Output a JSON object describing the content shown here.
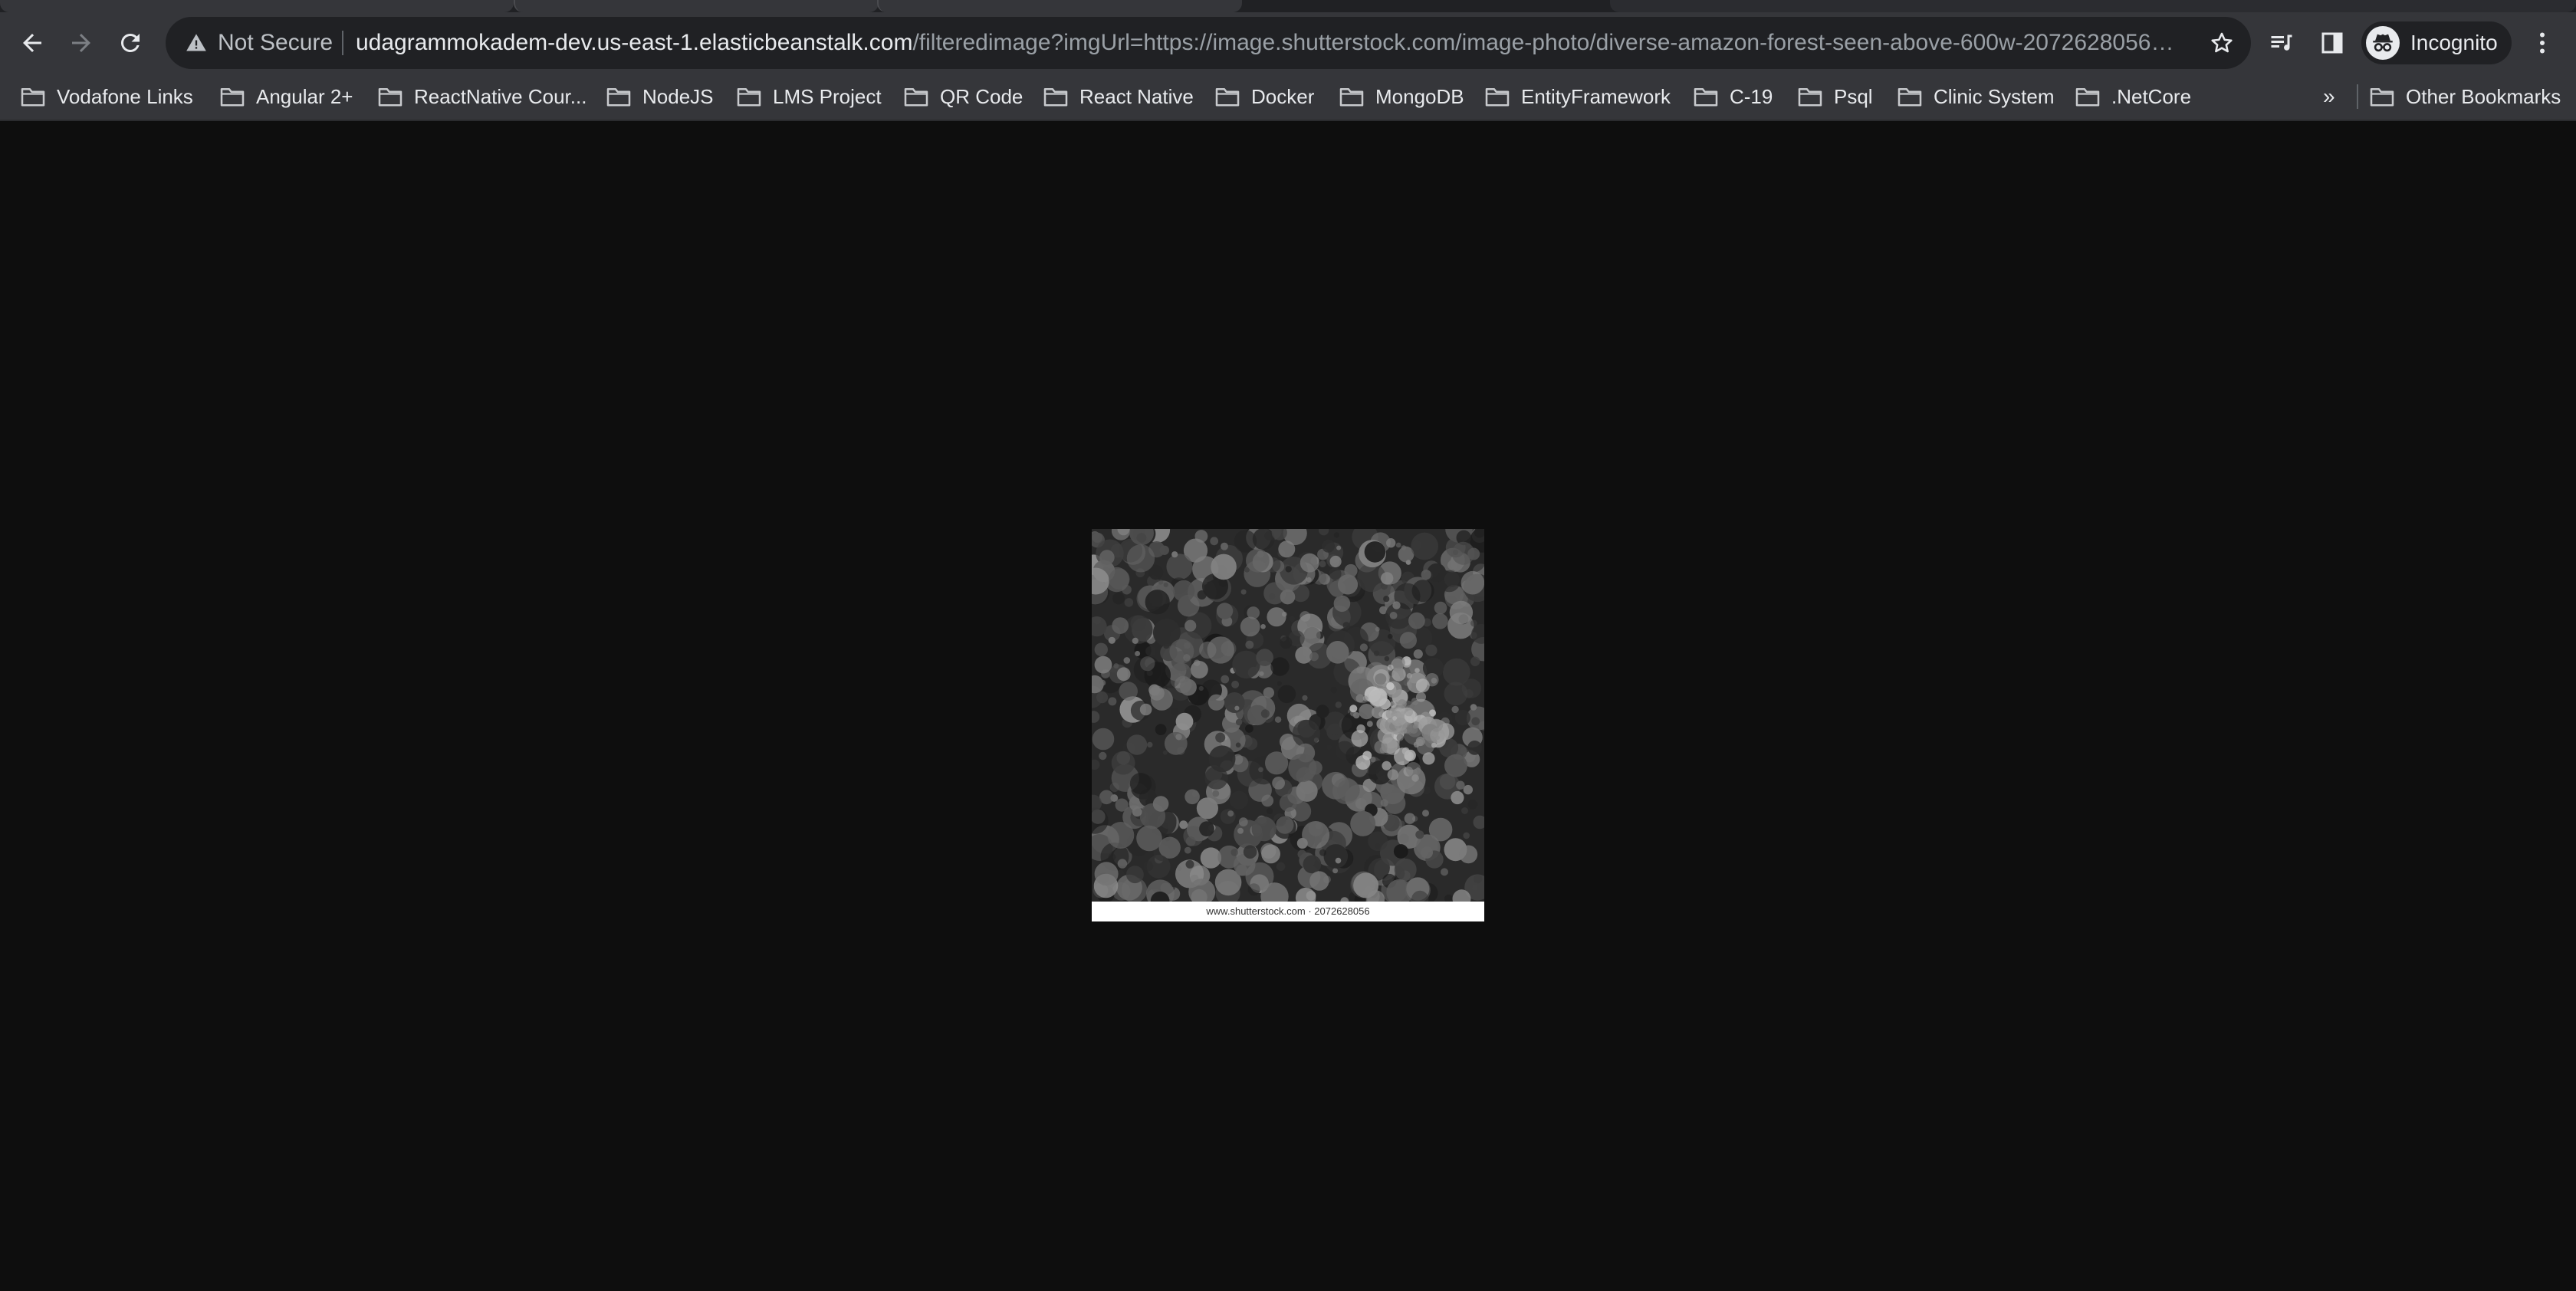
{
  "toolbar": {
    "security_text": "Not Secure",
    "url_host": "udagrammokadem-dev.us-east-1.elasticbeanstalk.com",
    "url_path": "/filteredimage?imgUrl=https://image.shutterstock.com/image-photo/diverse-amazon-forest-seen-above-600w-2072628056…",
    "profile_label": "Incognito"
  },
  "bookmarks": {
    "items": [
      {
        "label": "Vodafone Links"
      },
      {
        "label": "Angular 2+"
      },
      {
        "label": "ReactNative Cour..."
      },
      {
        "label": "NodeJS"
      },
      {
        "label": "LMS Project"
      },
      {
        "label": "QR Code"
      },
      {
        "label": "React Native"
      },
      {
        "label": "Docker"
      },
      {
        "label": "MongoDB"
      },
      {
        "label": "EntityFramework"
      },
      {
        "label": "C-19"
      },
      {
        "label": "Psql"
      },
      {
        "label": "Clinic System"
      },
      {
        "label": ".NetCore"
      }
    ],
    "overflow_label": "»",
    "other_label": "Other Bookmarks"
  },
  "content": {
    "image_caption": "www.shutterstock.com · 2072628056"
  },
  "colors": {
    "page_background": "#0e0e0e",
    "toolbar_background": "#35363a",
    "omnibox_background": "#202124"
  },
  "icons": {
    "back": "arrow-left-icon",
    "forward": "arrow-right-icon",
    "reload": "reload-icon",
    "warning": "warning-triangle-icon",
    "bookmark_star": "star-icon",
    "media": "media-control-icon",
    "side_panel": "side-panel-icon",
    "incognito": "incognito-icon",
    "menu": "kebab-menu-icon",
    "folder": "folder-icon"
  }
}
